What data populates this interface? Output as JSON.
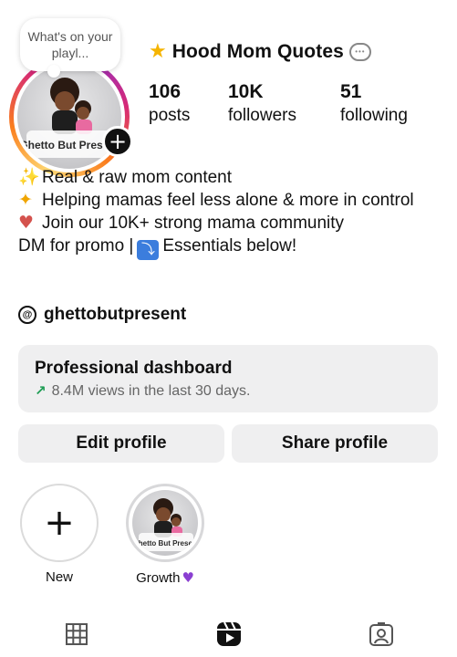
{
  "note": {
    "text": "What's on your playl..."
  },
  "profile": {
    "username": "Hood Mom Quotes",
    "stats": [
      {
        "value": "106",
        "label": "posts"
      },
      {
        "value": "10K",
        "label": "followers"
      },
      {
        "value": "51",
        "label": "following"
      }
    ],
    "avatar_text": "Ghetto But Present"
  },
  "bio": {
    "line1": "Real & raw mom content",
    "line2": "Helping mamas feel less alone & more in control",
    "line3": "Join our 10K+ strong mama community",
    "line4a": "DM for promo |",
    "line4b": "Essentials below!"
  },
  "threads": {
    "handle": "ghettobutpresent"
  },
  "dashboard": {
    "title": "Professional dashboard",
    "subtitle": "8.4M views in the last 30 days."
  },
  "buttons": {
    "edit": "Edit profile",
    "share": "Share profile"
  },
  "highlights": [
    {
      "label": "New"
    },
    {
      "label": "Growth"
    }
  ],
  "colors": {
    "ring_start": "#feda75",
    "ring_mid": "#d62976",
    "trend_green": "#1f9d55",
    "button_bg": "#efeff0"
  },
  "icons": [
    "star-icon",
    "speech-bubble-icon",
    "sparkles-icon",
    "dizzy-icon",
    "heart-hands-icon",
    "arrow-down-box-icon",
    "threads-icon",
    "trend-up-icon",
    "plus-icon",
    "purple-heart-icon",
    "grid-icon",
    "reels-icon",
    "tagged-icon"
  ]
}
